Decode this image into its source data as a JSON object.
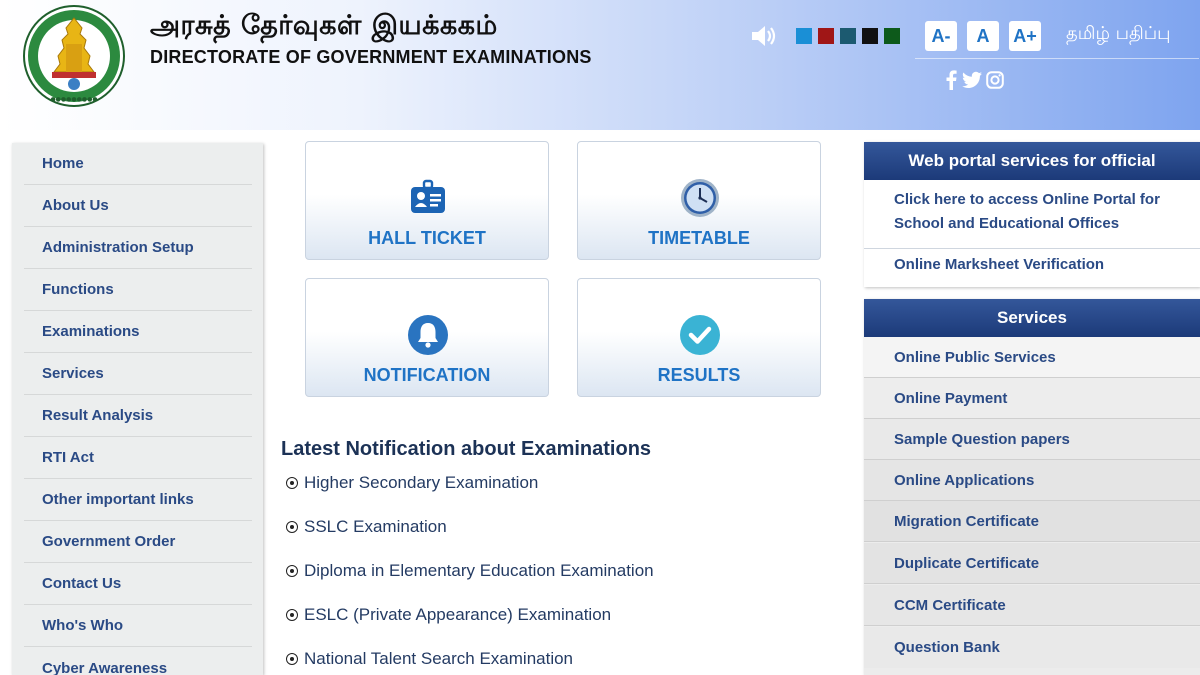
{
  "header": {
    "title_tamil": "அரசுத் தேர்வுகள் இயக்ககம்",
    "title_english": "DIRECTORATE OF GOVERNMENT EXAMINATIONS",
    "emblem_icon": "tamil-nadu-emblem",
    "speaker_icon": "speaker-icon",
    "theme_colors": [
      "#1a8fd6",
      "#a01616",
      "#1c5a70",
      "#111111",
      "#0d5a1b"
    ],
    "font_buttons": [
      "A-",
      "A",
      "A+"
    ],
    "language_toggle": "தமிழ் பதிப்பு",
    "social_icons": [
      "facebook-icon",
      "twitter-icon",
      "instagram-icon"
    ]
  },
  "left_nav": {
    "items": [
      "Home",
      "About Us",
      "Administration Setup",
      "Functions",
      "Examinations",
      "Services",
      "Result Analysis",
      "RTI Act",
      "Other important links",
      "Government Order",
      "Contact Us",
      "Who's Who",
      "Cyber Awareness"
    ]
  },
  "tiles": [
    {
      "label": "HALL TICKET",
      "icon": "id-card-icon"
    },
    {
      "label": "TIMETABLE",
      "icon": "clock-icon"
    },
    {
      "label": "NOTIFICATION",
      "icon": "bell-icon"
    },
    {
      "label": "RESULTS",
      "icon": "check-circle-icon"
    }
  ],
  "notifications": {
    "heading": "Latest Notification about Examinations",
    "items": [
      "Higher Secondary Examination",
      "SSLC Examination",
      "Diploma in Elementary Education Examination",
      "ESLC (Private Appearance) Examination",
      "National Talent Search Examination"
    ]
  },
  "official_panel": {
    "title": "Web portal services for official",
    "links": [
      "Click here to access Online Portal for School and Educational Offices",
      "Online Marksheet Verification"
    ]
  },
  "services_panel": {
    "title": "Services",
    "items": [
      "Online Public Services",
      "Online Payment",
      "Sample Question papers",
      "Online Applications",
      "Migration Certificate",
      "Duplicate Certificate",
      "CCM Certificate",
      "Question Bank"
    ]
  },
  "colors": {
    "nav_text": "#2a4a85",
    "tile_text": "#1f73c5",
    "panel_header": "#1c3a79"
  }
}
